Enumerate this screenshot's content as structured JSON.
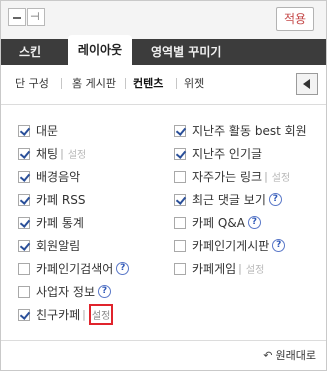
{
  "toolbar": {
    "apply_label": "적용",
    "pin_glyph": "⊣"
  },
  "tabs": [
    {
      "label": "스킨"
    },
    {
      "label": "레이아웃"
    },
    {
      "label": "영역별 꾸미기"
    }
  ],
  "subnav": [
    {
      "label": "단 구성"
    },
    {
      "label": "홈 게시판"
    },
    {
      "label": "컨텐츠"
    },
    {
      "label": "위젯"
    }
  ],
  "settings_label": "설정",
  "help_glyph": "?",
  "left_items": [
    {
      "label": "대문",
      "checked": true
    },
    {
      "label": "채팅",
      "checked": true
    },
    {
      "label": "배경음악",
      "checked": true
    },
    {
      "label": "카페 RSS",
      "checked": true
    },
    {
      "label": "카페 통계",
      "checked": true
    },
    {
      "label": "회원알림",
      "checked": true
    },
    {
      "label": "카페인기검색어",
      "checked": false
    },
    {
      "label": "사업자 정보",
      "checked": false
    },
    {
      "label": "친구카페",
      "checked": true
    }
  ],
  "right_items": [
    {
      "label": "지난주 활동 best 회원",
      "checked": true
    },
    {
      "label": "지난주 인기글",
      "checked": true
    },
    {
      "label": "자주가는 링크",
      "checked": false
    },
    {
      "label": "최근 댓글 보기",
      "checked": true
    },
    {
      "label": "카페 Q&A",
      "checked": false
    },
    {
      "label": "카페인기게시판",
      "checked": false
    },
    {
      "label": "카페게임",
      "checked": false
    }
  ],
  "footer": {
    "reset_label": "원래대로",
    "reset_glyph": "↶"
  }
}
